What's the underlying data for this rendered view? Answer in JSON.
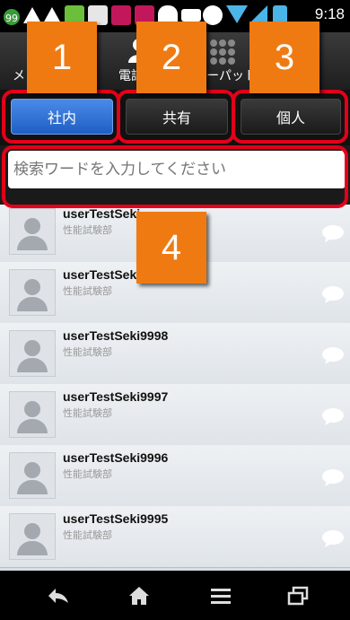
{
  "status_bar": {
    "time": "9:18",
    "notif_count": "99"
  },
  "tabs": [
    {
      "label": "メ",
      "icon": "mail-icon"
    },
    {
      "label": "電話",
      "icon": "person-icon"
    },
    {
      "label": "ーパット",
      "icon": "keypad-icon"
    }
  ],
  "annotations": [
    "1",
    "2",
    "3",
    "4"
  ],
  "segments": [
    {
      "label": "社内",
      "selected": true
    },
    {
      "label": "共有",
      "selected": false
    },
    {
      "label": "個人",
      "selected": false
    }
  ],
  "search": {
    "placeholder": "検索ワードを入力してください"
  },
  "contacts": [
    {
      "name": "userTestSeki",
      "dept": "性能試験部"
    },
    {
      "name": "userTestSeki",
      "dept": "性能試験部"
    },
    {
      "name": "userTestSeki9998",
      "dept": "性能試験部"
    },
    {
      "name": "userTestSeki9997",
      "dept": "性能試験部"
    },
    {
      "name": "userTestSeki9996",
      "dept": "性能試験部"
    },
    {
      "name": "userTestSeki9995",
      "dept": "性能試験部"
    }
  ],
  "colors": {
    "accent_annotation": "#f07a12",
    "highlight_outline": "#e3001a",
    "selected_segment": "#2f6fd6"
  },
  "nav": [
    "back-icon",
    "home-icon",
    "menu-icon",
    "recent-apps-icon"
  ]
}
